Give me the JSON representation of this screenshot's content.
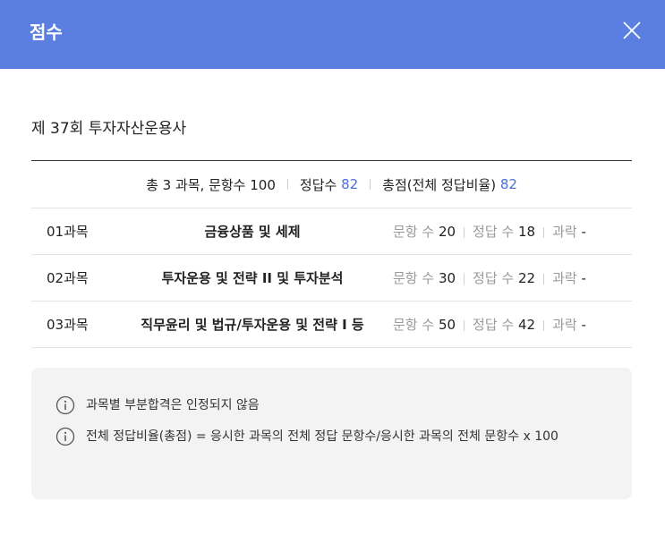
{
  "header": {
    "title": "점수"
  },
  "exam": {
    "title": "제 37회 투자자산운용사"
  },
  "summary": {
    "subjects_label": "총 3 과목, 문항수 100",
    "correct_label": "정답수",
    "correct_value": "82",
    "score_label": "총점(전체 정답비율)",
    "score_value": "82"
  },
  "rows": [
    {
      "code": "01과목",
      "name": "금융상품 및 세제",
      "q_label": "문항 수",
      "q_value": "20",
      "c_label": "정답 수",
      "c_value": "18",
      "pass_label": "과락",
      "pass_value": "-"
    },
    {
      "code": "02과목",
      "name": "투자운용 및 전략 II 및 투자분석",
      "q_label": "문항 수",
      "q_value": "30",
      "c_label": "정답 수",
      "c_value": "22",
      "pass_label": "과락",
      "pass_value": "-"
    },
    {
      "code": "03과목",
      "name": "직무윤리 및 법규/투자운용 및 전략 I 등",
      "q_label": "문항 수",
      "q_value": "50",
      "c_label": "정답 수",
      "c_value": "42",
      "pass_label": "과락",
      "pass_value": "-"
    }
  ],
  "notes": [
    "과목별 부분합격은 인정되지 않음",
    "전체 정답비율(총점) = 응시한 과목의 전체 정답 문항수/응시한 과목의 전체 문항수 x 100"
  ],
  "colors": {
    "header": "#5b7fe0",
    "accent": "#4a6fd8"
  },
  "icons": {
    "close": "close-icon",
    "info": "info-icon"
  }
}
